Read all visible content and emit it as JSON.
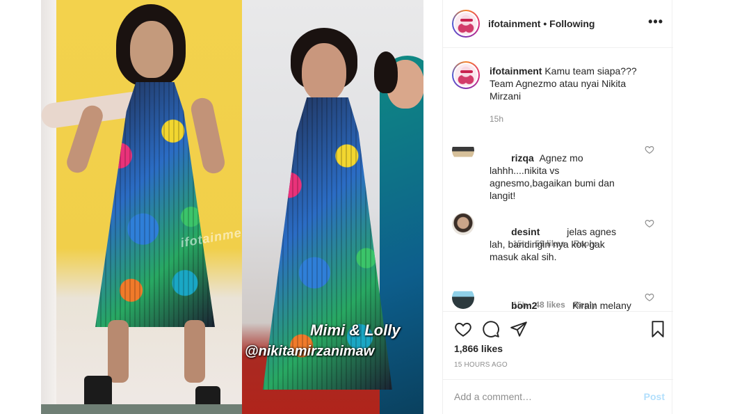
{
  "post": {
    "image_overlay": {
      "watermark": "ifotainment",
      "caption_line1": "Mimi & Lolly",
      "caption_line2": "@nikitamirzanimaw"
    }
  },
  "header": {
    "username": "ifotainment",
    "separator": "•",
    "follow_status": "Following",
    "more_icon": "more-options-icon"
  },
  "caption": {
    "username": "ifotainment",
    "text": "Kamu team siapa??? Team Agnezmo atau nyai Nikita Mirzani",
    "time": "15h"
  },
  "comments": [
    {
      "username": "rizqa",
      "text": "Agnez mo lahhh....nikita vs agnesmo,bagaikan bumi dan langit!",
      "time": "15h",
      "likes": "59 likes",
      "reply": "Reply"
    },
    {
      "username": "desint",
      "text": "jelas agnes lah, bandingin nya kok gak masuk akal sih.",
      "time": "15h",
      "likes": "48 likes",
      "reply": "Reply"
    },
    {
      "username": "bom2",
      "text": "Kirain melany Ricardo hehe",
      "time": "",
      "likes": "",
      "reply": ""
    }
  ],
  "actions": {
    "likes": "1,866 likes",
    "timestamp": "15 HOURS AGO",
    "icons": [
      "heart-icon",
      "comment-icon",
      "share-icon",
      "bookmark-icon"
    ]
  },
  "add_comment": {
    "placeholder": "Add a comment…",
    "post_label": "Post",
    "post_color": "#b2dffc"
  }
}
